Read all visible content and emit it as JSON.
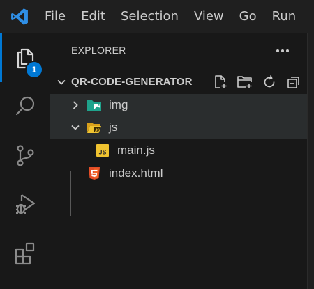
{
  "menubar": {
    "items": [
      "File",
      "Edit",
      "Selection",
      "View",
      "Go",
      "Run"
    ]
  },
  "activity_bar": {
    "explorer_badge": "1",
    "accent_color": "#0078d4"
  },
  "sidebar": {
    "header": "EXPLORER",
    "folder_name": "QR-CODE-GENERATOR",
    "tree": [
      {
        "label": "img",
        "kind": "folder",
        "icon": "image-folder-icon",
        "expanded": false
      },
      {
        "label": "js",
        "kind": "folder",
        "icon": "js-folder-icon",
        "expanded": true
      },
      {
        "label": "main.js",
        "kind": "file",
        "icon": "js-file-icon",
        "icon_text": "JS"
      },
      {
        "label": "index.html",
        "kind": "file",
        "icon": "html5-file-icon"
      }
    ]
  }
}
